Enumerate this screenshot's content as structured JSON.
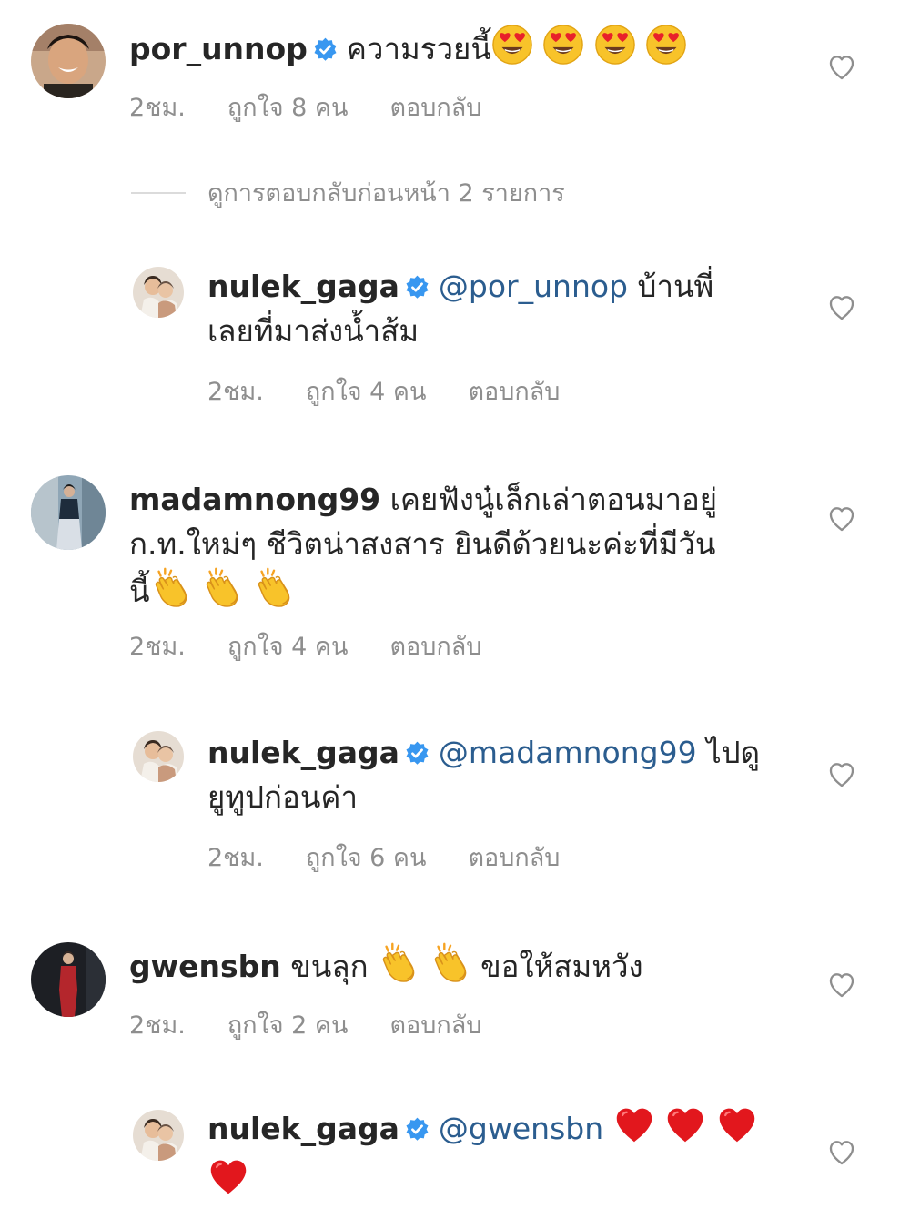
{
  "comments": [
    {
      "username": "por_unnop",
      "verified": true,
      "text": "ความรวยนี้",
      "emoji": "heart-eyes-emoji x4",
      "time": "2ชม.",
      "likes": "ถูกใจ 8 คน",
      "reply": "ตอบกลับ"
    },
    {
      "username": "nulek_gaga",
      "verified": true,
      "mention": "@por_unnop",
      "text_line1": "บ้านพี่",
      "text_line2": "เลยที่มาส่งน้ำส้ม",
      "time": "2ชม.",
      "likes": "ถูกใจ 4 คน",
      "reply": "ตอบกลับ"
    },
    {
      "username": "madamnong99",
      "verified": false,
      "text_line1": "เคยฟังนู๋เล็กเล่าตอนมาอยู่",
      "text_line2": "ก.ท.ใหม่ๆ ชีวิตน่าสงสาร ยินดีด้วยนะค่ะที่มีวัน",
      "text_line3": "นี้",
      "emoji": "clapping-hands-emoji x3",
      "time": "2ชม.",
      "likes": "ถูกใจ 4 คน",
      "reply": "ตอบกลับ"
    },
    {
      "username": "nulek_gaga",
      "verified": true,
      "mention": "@madamnong99",
      "text_line1": "ไปดู",
      "text_line2": "ยูทูปก่อนค่า",
      "time": "2ชม.",
      "likes": "ถูกใจ 6 คน",
      "reply": "ตอบกลับ"
    },
    {
      "username": "gwensbn",
      "verified": false,
      "text_before": "ขนลุก",
      "text_after": "ขอให้สมหวัง",
      "emoji": "clapping-hands-emoji x2",
      "time": "2ชม.",
      "likes": "ถูกใจ 2 คน",
      "reply": "ตอบกลับ"
    },
    {
      "username": "nulek_gaga",
      "verified": true,
      "mention": "@gwensbn",
      "emoji": "red-heart-emoji x4"
    }
  ],
  "view_replies": "ดูการตอบกลับก่อนหน้า 2 รายการ",
  "colors": {
    "text": "#262626",
    "meta": "#8e8e8e",
    "mention": "#2b5d8f",
    "verified": "#3897f0",
    "heart_outline": "#8e8e8e"
  }
}
